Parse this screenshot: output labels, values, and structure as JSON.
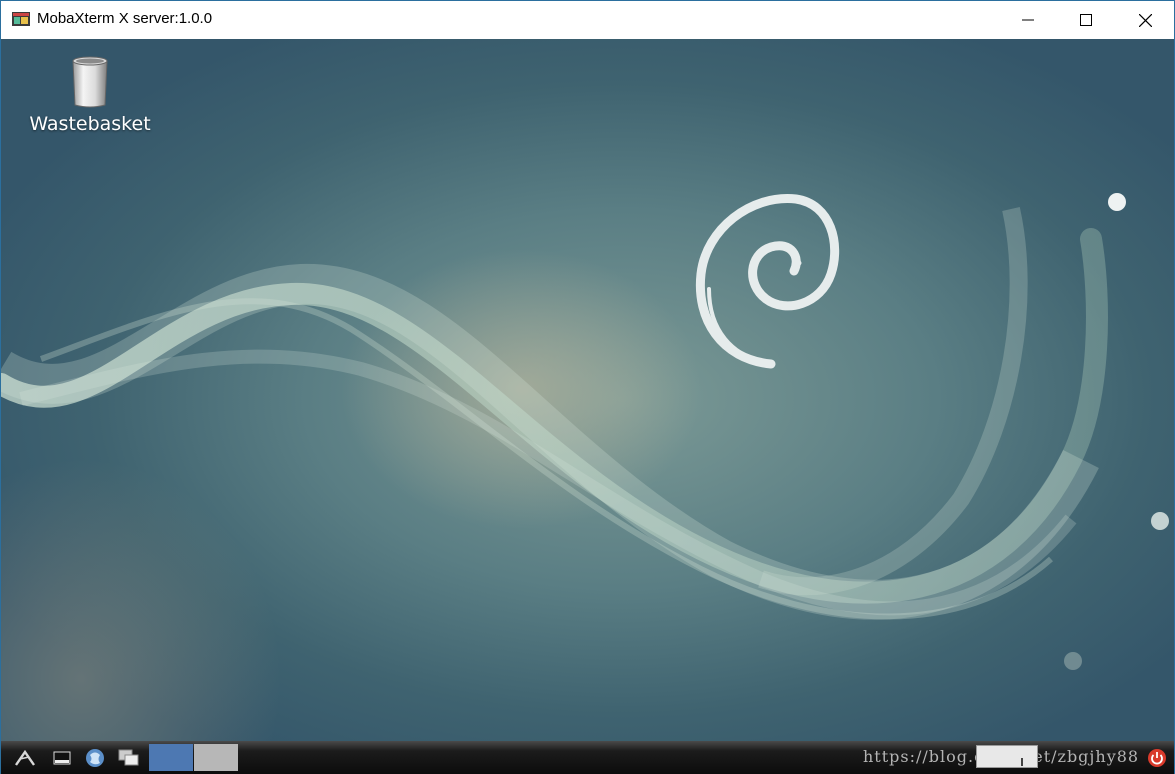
{
  "window": {
    "title": "MobaXterm X server:1.0.0",
    "controls": [
      "minimize",
      "maximize",
      "close"
    ]
  },
  "desktop": {
    "icons": [
      {
        "label": "Wastebasket",
        "icon": "wastebasket-icon"
      }
    ],
    "wallpaper": "debian-swirl"
  },
  "taskbar": {
    "launchers": [
      "menu-icon",
      "terminal-icon",
      "web-browser-icon",
      "window-list-icon"
    ],
    "workspaces": [
      {
        "name": "workspace-1",
        "active": true,
        "color": "#4d78b2"
      },
      {
        "name": "workspace-2",
        "active": false,
        "color": "#b7b7b7"
      }
    ],
    "watermark": "https://blog.csdn.net/zbgjhy88"
  },
  "colors": {
    "accent": "#4d78b2",
    "power": "#d93a2b"
  }
}
